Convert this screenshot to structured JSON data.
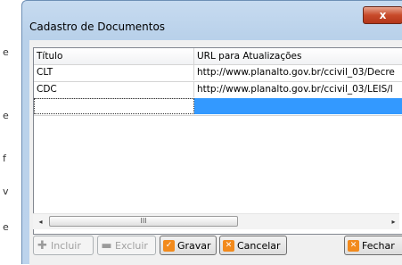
{
  "window": {
    "title": "Cadastro de Documentos",
    "close_label": "x"
  },
  "background": {
    "letters": [
      "e",
      "e",
      "f",
      "v",
      "e"
    ]
  },
  "grid": {
    "columns": [
      "Título",
      "URL para Atualizações"
    ],
    "rows": [
      [
        "CLT",
        "http://www.planalto.gov.br/ccivil_03/Decre"
      ],
      [
        "CDC",
        "http://www.planalto.gov.br/ccivil_03/LEIS/l"
      ],
      [
        "",
        ""
      ]
    ]
  },
  "scrollbar": {
    "left_arrow": "◂",
    "right_arrow": "▸",
    "thumb_grip": "III"
  },
  "buttons": {
    "incluir": "Incluir",
    "excluir": "Excluir",
    "gravar": "Gravar",
    "cancelar": "Cancelar",
    "fechar": "Fechar"
  }
}
